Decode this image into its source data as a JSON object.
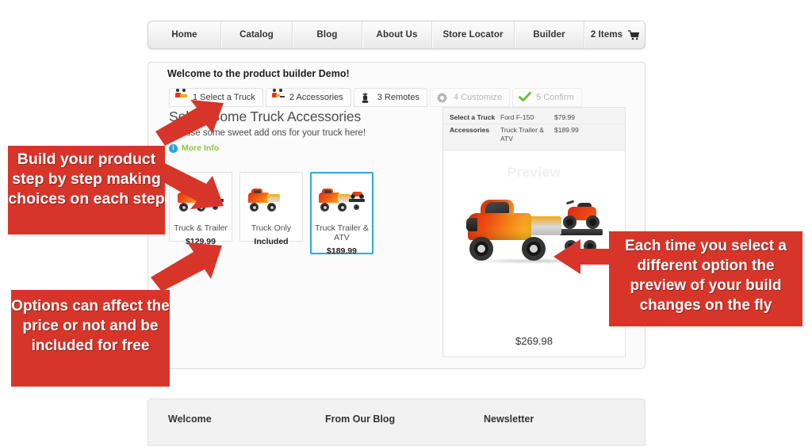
{
  "nav": {
    "items": [
      {
        "label": "Home",
        "name": "nav-item-home"
      },
      {
        "label": "Catalog",
        "name": "nav-item-catalog"
      },
      {
        "label": "Blog",
        "name": "nav-item-blog"
      },
      {
        "label": "About Us",
        "name": "nav-item-about-us"
      },
      {
        "label": "Store Locator",
        "name": "nav-item-store-locator"
      },
      {
        "label": "Builder",
        "name": "nav-item-builder"
      }
    ],
    "cart_label": "2 Items",
    "cart_icon": "shopping-cart-icon"
  },
  "builder": {
    "welcome_title": "Welcome to the product builder Demo!",
    "steps": [
      {
        "number": "1",
        "label": "1 Select a Truck",
        "icon": "truck-icon",
        "state": "available"
      },
      {
        "number": "2",
        "label": "2 Accessories",
        "icon": "truck-trailer-icon",
        "state": "active"
      },
      {
        "number": "3",
        "label": "3 Remotes",
        "icon": "remote-control-icon",
        "state": "available"
      },
      {
        "number": "4",
        "label": "4 Customize",
        "icon": "gear-icon",
        "state": "disabled"
      },
      {
        "number": "5",
        "label": "5 Confirm",
        "icon": "checkmark-icon",
        "state": "disabled"
      }
    ],
    "section_heading": "Select Some Truck Accessories",
    "section_subheading": "Choose some sweet add ons for your truck here!",
    "more_info_label": "More Info",
    "more_info_icon": "info-circle-icon",
    "options": [
      {
        "label": "Truck & Trailer",
        "price": "$129.99",
        "selected": false,
        "image": "truck-with-trailer-thumbnail"
      },
      {
        "label": "Truck Only",
        "price": "Included",
        "selected": false,
        "image": "truck-only-thumbnail"
      },
      {
        "label": "Truck Trailer & ATV",
        "price": "$189.99",
        "selected": true,
        "image": "truck-trailer-atv-thumbnail"
      }
    ]
  },
  "preview": {
    "watermark": "Preview",
    "summary_rows": [
      {
        "key": "Select a Truck",
        "value": "Ford F-150",
        "price": "$79.99"
      },
      {
        "key": "Accessories",
        "value": "Truck Trailer & ATV",
        "price": "$189.99"
      }
    ],
    "image": "truck-trailer-atv-preview",
    "total_price": "$269.98"
  },
  "footer": {
    "columns": [
      "Welcome",
      "From Our Blog",
      "Newsletter"
    ]
  },
  "annotations": {
    "accent_color": "#d8352a",
    "callouts": [
      {
        "name": "callout-build-step-by-step",
        "text": "Build your product step by step making choices on each step"
      },
      {
        "name": "callout-options-affect-price",
        "text": "Options can affect the price or not and be included for free"
      },
      {
        "name": "callout-preview-updates",
        "text": "Each time you select a different option the preview of your build changes on the fly"
      }
    ]
  },
  "theme": {
    "selected_border": "#2aa9e0",
    "link_green": "#8cc63f",
    "info_blue": "#29a3dd"
  }
}
